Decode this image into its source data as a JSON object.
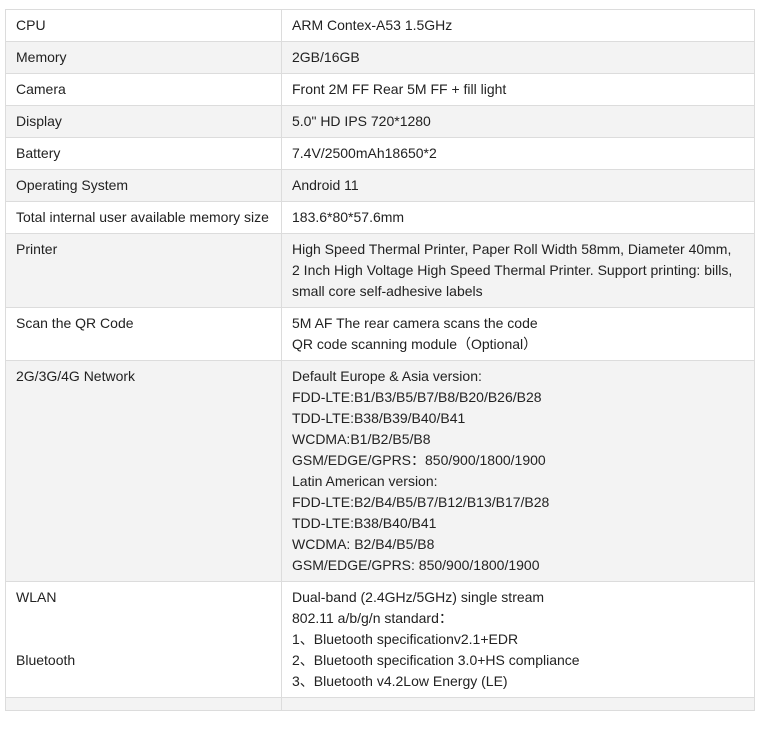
{
  "rows": [
    {
      "label": "CPU",
      "value": [
        "ARM Contex-A53 1.5GHz"
      ]
    },
    {
      "label": "Memory",
      "value": [
        "2GB/16GB"
      ]
    },
    {
      "label": "Camera",
      "value": [
        "Front 2M FF Rear 5M FF + fill light"
      ]
    },
    {
      "label": "Display",
      "value": [
        "5.0\" HD IPS 720*1280"
      ]
    },
    {
      "label": "Battery",
      "value": [
        "7.4V/2500mAh18650*2"
      ]
    },
    {
      "label": "Operating System",
      "value": [
        "Android 11"
      ]
    },
    {
      "label": "Total internal user available memory size",
      "value": [
        "183.6*80*57.6mm"
      ]
    },
    {
      "label": "Printer",
      "value": [
        "High Speed Thermal Printer, Paper Roll Width 58mm, Diameter 40mm,",
        "2 Inch High Voltage High Speed Thermal Printer. Support printing: bills,",
        "small core self-adhesive labels"
      ]
    },
    {
      "label": "Scan the QR Code",
      "value": [
        "5M AF The rear camera scans the code",
        "QR code scanning module（Optional）"
      ]
    },
    {
      "label": "2G/3G/4G Network",
      "value": [
        "Default Europe & Asia version:",
        "FDD-LTE:B1/B3/B5/B7/B8/B20/B26/B28",
        "TDD-LTE:B38/B39/B40/B41",
        "WCDMA:B1/B2/B5/B8",
        "GSM/EDGE/GPRS：850/900/1800/1900",
        "Latin American version:",
        "FDD-LTE:B2/B4/B5/B7/B12/B13/B17/B28",
        "TDD-LTE:B38/B40/B41",
        "WCDMA: B2/B4/B5/B8",
        "GSM/EDGE/GPRS: 850/900/1800/1900"
      ]
    },
    {
      "label_wlan": "WLAN",
      "label_bt": "Bluetooth",
      "value": [
        "Dual-band (2.4GHz/5GHz) single stream",
        "802.11 a/b/g/n standard：",
        "1、Bluetooth specificationv2.1+EDR",
        "2、Bluetooth specification 3.0+HS compliance",
        "3、Bluetooth v4.2Low Energy (LE)"
      ]
    }
  ]
}
